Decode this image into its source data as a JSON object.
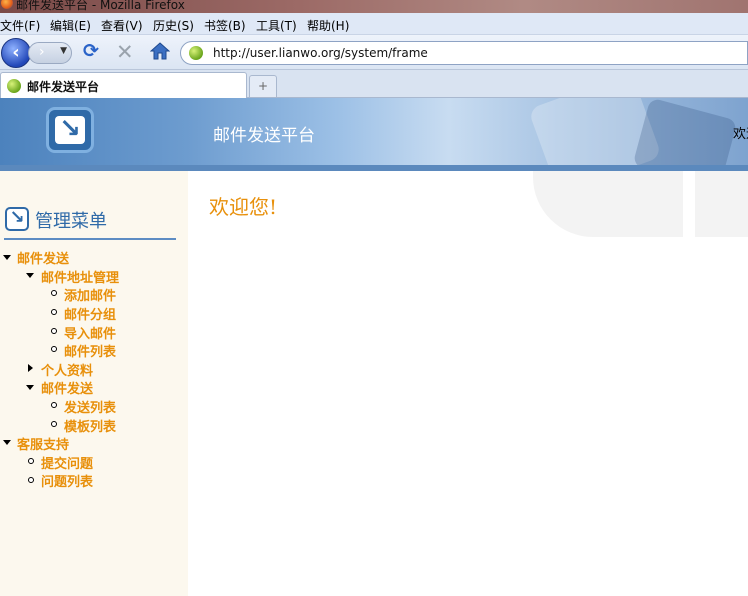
{
  "window": {
    "title": "邮件发送平台 - Mozilla Firefox"
  },
  "menubar": {
    "items": [
      "文件(F)",
      "编辑(E)",
      "查看(V)",
      "历史(S)",
      "书签(B)",
      "工具(T)",
      "帮助(H)"
    ]
  },
  "navbar": {
    "url": "http://user.lianwo.org/system/frame",
    "icons": [
      "back-icon",
      "forward-icon",
      "reload-icon",
      "stop-icon",
      "home-icon"
    ]
  },
  "tabs": [
    {
      "label": "邮件发送平台"
    }
  ],
  "newtab_symbol": "+",
  "site": {
    "title": "邮件发送平台",
    "welcome_right": "欢迎",
    "welcome_main": "欢迎您!"
  },
  "sidebar": {
    "heading": "管理菜单",
    "tree": [
      {
        "label": "邮件发送",
        "expanded": true,
        "children": [
          {
            "label": "邮件地址管理",
            "expanded": true,
            "children": [
              {
                "label": "添加邮件"
              },
              {
                "label": "邮件分组"
              },
              {
                "label": "导入邮件"
              },
              {
                "label": "邮件列表"
              }
            ]
          },
          {
            "label": "个人资料",
            "expanded": false
          },
          {
            "label": "邮件发送",
            "expanded": true,
            "children": [
              {
                "label": "发送列表"
              },
              {
                "label": "模板列表"
              }
            ]
          }
        ]
      },
      {
        "label": "客服支持",
        "expanded": true,
        "children": [
          {
            "label": "提交问题"
          },
          {
            "label": "问题列表"
          }
        ]
      }
    ]
  },
  "colors": {
    "menu_text": "#e8900b",
    "heading_blue": "#2f6aa8",
    "sidebar_bg": "#fcf8ee"
  }
}
